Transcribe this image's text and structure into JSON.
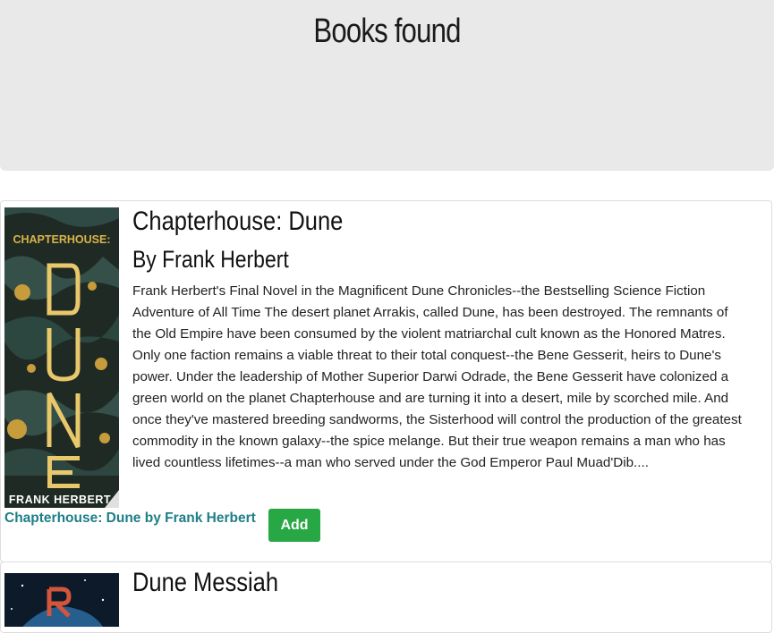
{
  "header": {
    "title": "Books found"
  },
  "books": [
    {
      "title": "Chapterhouse: Dune",
      "author_line": "By Frank Herbert",
      "description": "Frank Herbert's Final Novel in the Magnificent Dune Chronicles--the Bestselling Science Fiction Adventure of All Time The desert planet Arrakis, called Dune, has been destroyed. The remnants of the Old Empire have been consumed by the violent matriarchal cult known as the Honored Matres. Only one faction remains a viable threat to their total conquest--the Bene Gesserit, heirs to Dune's power. Under the leadership of Mother Superior Darwi Odrade, the Bene Gesserit have colonized a green world on the planet Chapterhouse and are turning it into a desert, mile by scorched mile. And once they've mastered breeding sandworms, the Sisterhood will control the production of the greatest commodity in the known galaxy--the spice melange. But their true weapon remains a man who has lived countless lifetimes--a man who served under the God Emperor Paul Muad'Dib....",
      "link_text": "Chapterhouse: Dune by Frank Herbert",
      "add_label": "Add",
      "cover": {
        "top_text": "CHAPTERHOUSE:",
        "big_text": "DUNE",
        "bottom_text": "FRANK HERBERT",
        "bg_color": "#1f2a24",
        "accent_color": "#d9b34a"
      }
    },
    {
      "title": "Dune Messiah"
    }
  ],
  "colors": {
    "link": "#1e7e86",
    "add_button": "#28a745",
    "jumbotron_bg": "#e9e9e9"
  }
}
